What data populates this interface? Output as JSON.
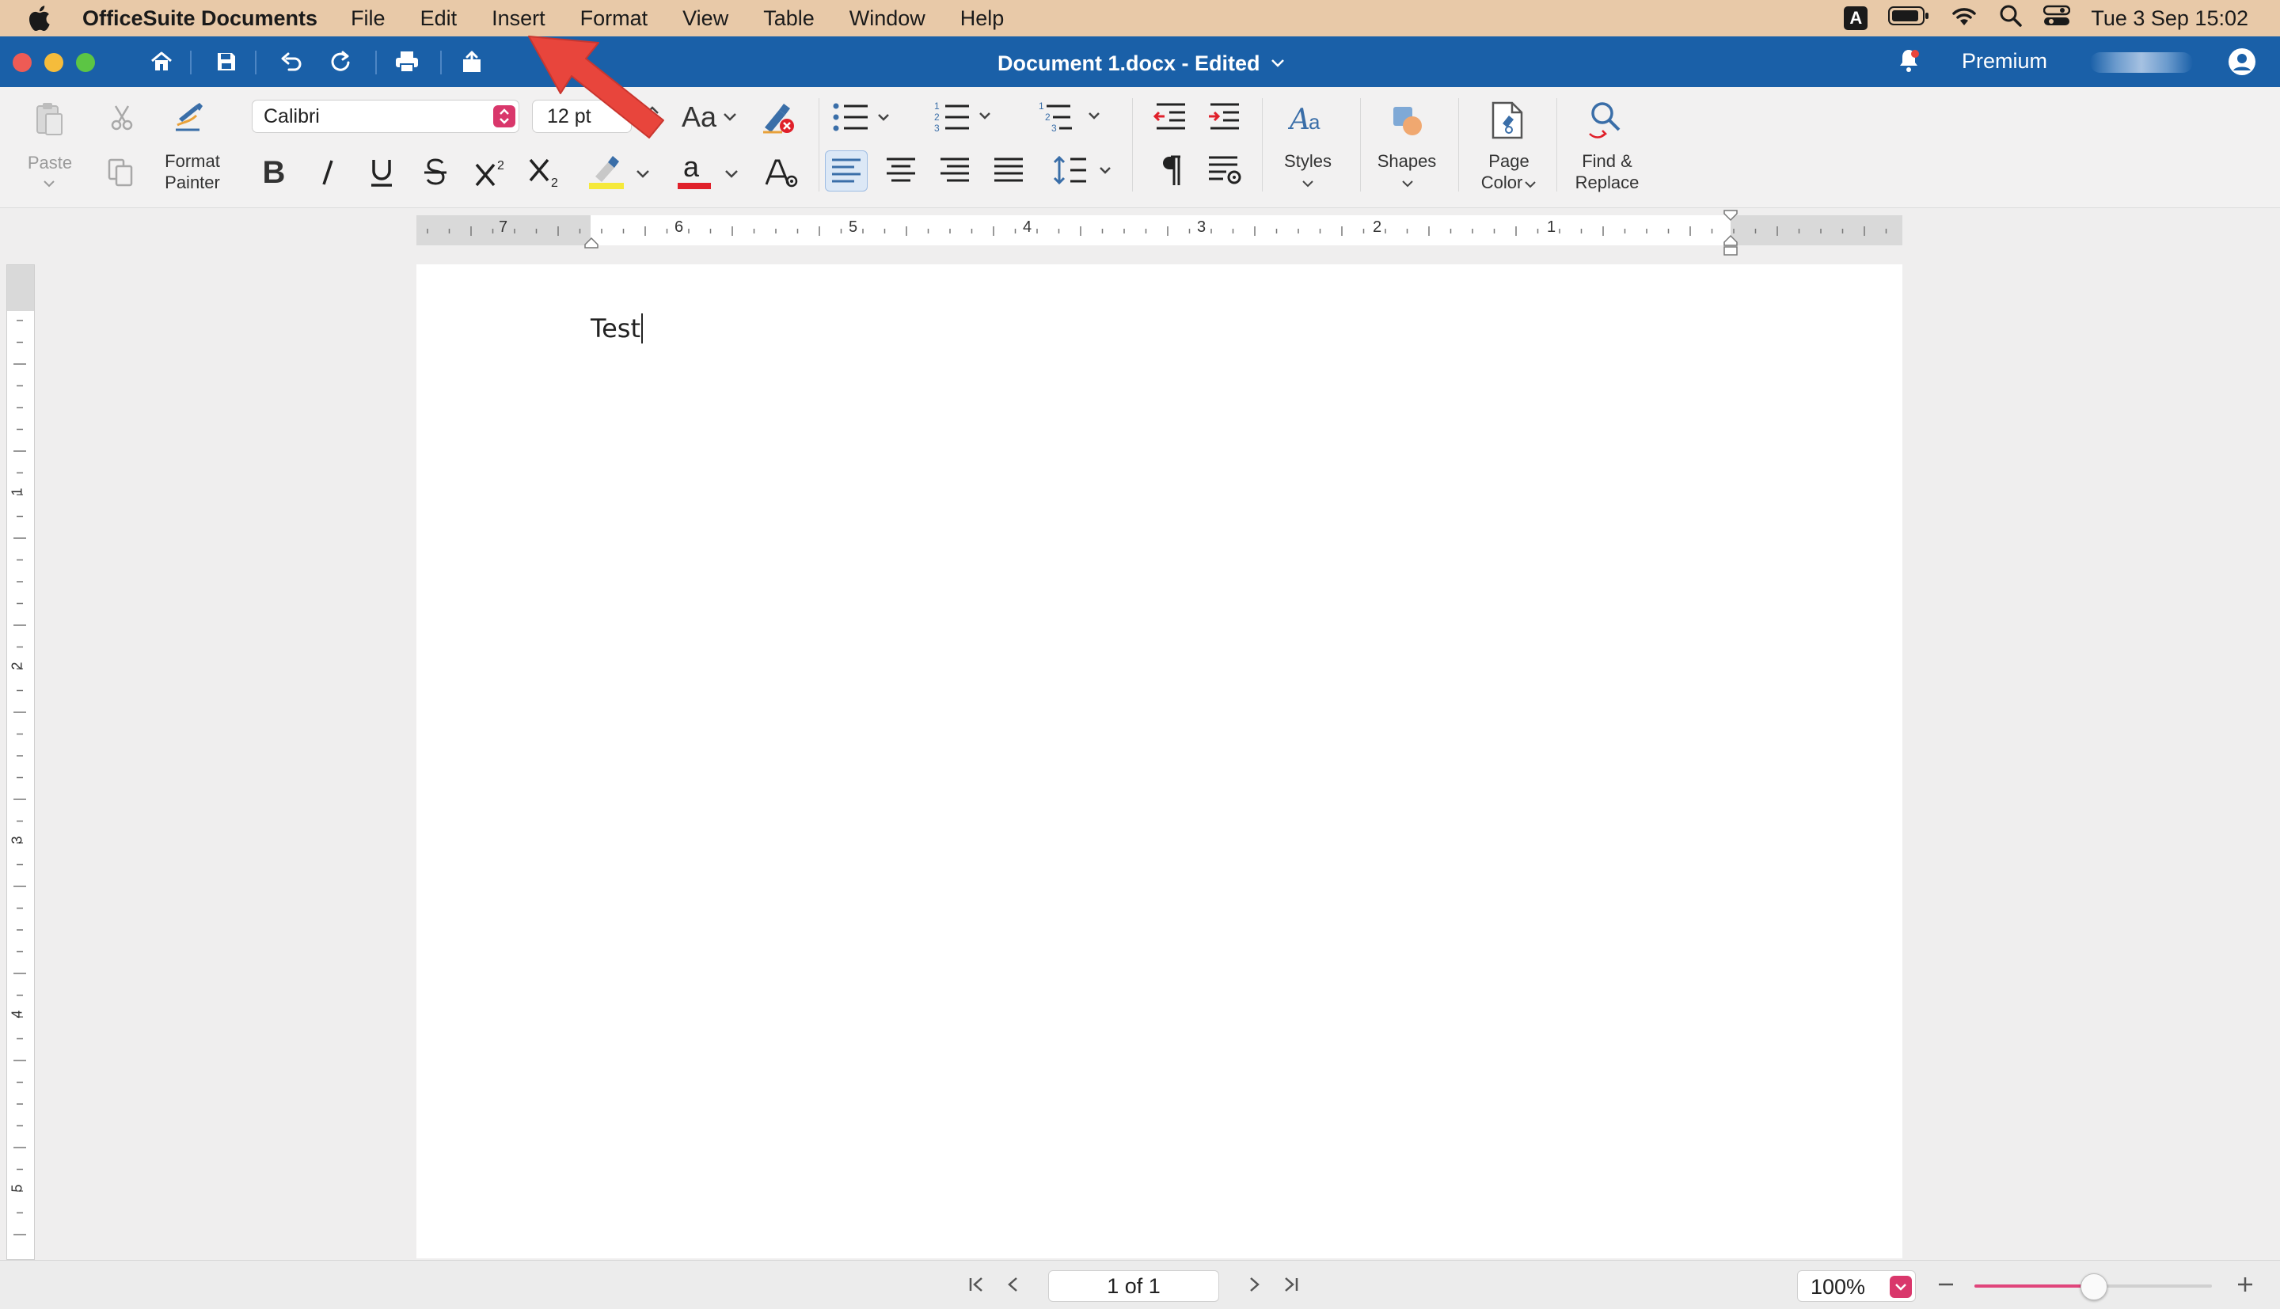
{
  "menubar": {
    "app_name": "OfficeSuite Documents",
    "items": [
      "File",
      "Edit",
      "Insert",
      "Format",
      "View",
      "Table",
      "Window",
      "Help"
    ],
    "input_source": "A",
    "clock": "Tue 3 Sep  15:02"
  },
  "titlebar": {
    "document_title": "Document 1.docx - Edited",
    "premium_label": "Premium"
  },
  "ribbon": {
    "paste_label": "Paste",
    "format_painter_label_1": "Format",
    "format_painter_label_2": "Painter",
    "font_name": "Calibri",
    "font_size": "12 pt",
    "font_case_label": "Aa",
    "styles_label": "Styles",
    "shapes_label": "Shapes",
    "page_color_label_1": "Page",
    "page_color_label_2": "Color",
    "find_replace_label_1": "Find &",
    "find_replace_label_2": "Replace"
  },
  "ruler": {
    "horizontal_numbers": [
      "7",
      "6",
      "5",
      "4",
      "3",
      "2",
      "1"
    ],
    "vertical_numbers": [
      "1",
      "2",
      "3",
      "4",
      "5"
    ]
  },
  "document": {
    "text": "Test"
  },
  "statusbar": {
    "page_indicator": "1 of 1",
    "zoom_value": "100%",
    "zoom_slider_fraction": 0.5
  },
  "colors": {
    "title_bar": "#1a60a8",
    "menubar": "#e8c9a8",
    "accent_pink": "#d9376b",
    "annotation_arrow": "#e8453c",
    "highlight_yellow": "#f5e93a",
    "font_color_red": "#e0202a"
  }
}
